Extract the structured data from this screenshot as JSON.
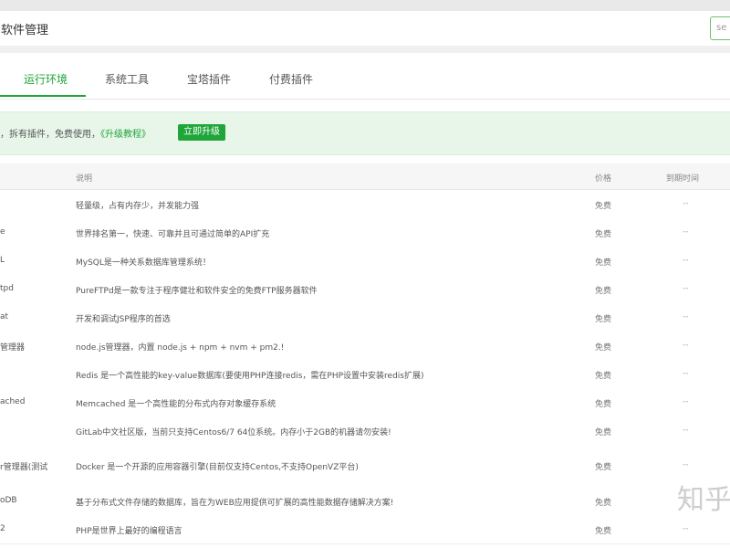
{
  "header": {
    "title": "软件管理",
    "search_placeholder": "se"
  },
  "tabs": [
    {
      "label": "运行环境",
      "active": true
    },
    {
      "label": "系统工具",
      "active": false
    },
    {
      "label": "宝塔插件",
      "active": false
    },
    {
      "label": "付费插件",
      "active": false
    }
  ],
  "notice": {
    "text": "，拆有插件，免费使用，",
    "link": "《升级教程》",
    "button": "立即升级"
  },
  "table": {
    "headers": {
      "desc": "说明",
      "price": "价格",
      "expire": "到期时间"
    },
    "rows": [
      {
        "name": "",
        "desc": "轻量级，占有内存少，并发能力强",
        "price": "免费",
        "expire": "--"
      },
      {
        "name": "e",
        "desc": "世界排名第一，快速、可靠并且可通过简单的API扩充",
        "price": "免费",
        "expire": "--"
      },
      {
        "name": "L",
        "desc": "MySQL是一种关系数据库管理系统！",
        "price": "免费",
        "expire": "--"
      },
      {
        "name": "tpd",
        "desc": "PureFTPd是一款专注于程序健壮和软件安全的免费FTP服务器软件",
        "price": "免费",
        "expire": "--"
      },
      {
        "name": "at",
        "desc": "开发和调试JSP程序的首选",
        "price": "免费",
        "expire": "--"
      },
      {
        "name": "管理器",
        "desc": "node.js管理器，内置 node.js + npm + nvm + pm2.!",
        "price": "免费",
        "expire": "--"
      },
      {
        "name": "",
        "desc": "Redis 是一个高性能的key-value数据库(要使用PHP连接redis，需在PHP设置中安装redis扩展)",
        "price": "免费",
        "expire": "--"
      },
      {
        "name": "ached",
        "desc": "Memcached 是一个高性能的分布式内存对象缓存系统",
        "price": "免费",
        "expire": "--"
      },
      {
        "name": "",
        "desc": "GitLab中文社区版，当前只支持Centos6/7 64位系统。内存小于2GB的机器请勿安装!",
        "price": "免费",
        "expire": "--"
      },
      {
        "name": "r管理器(测试",
        "desc": "Docker 是一个开源的应用容器引擎(目前仅支持Centos,不支持OpenVZ平台)",
        "price": "免费",
        "expire": "--"
      },
      {
        "name": "oDB",
        "desc": "基于分布式文件存储的数据库，旨在为WEB应用提供可扩展的高性能数据存储解决方案!",
        "price": "免费",
        "expire": "--"
      },
      {
        "name": "2",
        "desc": "PHP是世界上最好的编程语言",
        "price": "免费",
        "expire": "--"
      }
    ]
  },
  "watermark": "知乎",
  "colors": {
    "accent": "#20a53a",
    "notice_bg": "#e8f6ea"
  }
}
